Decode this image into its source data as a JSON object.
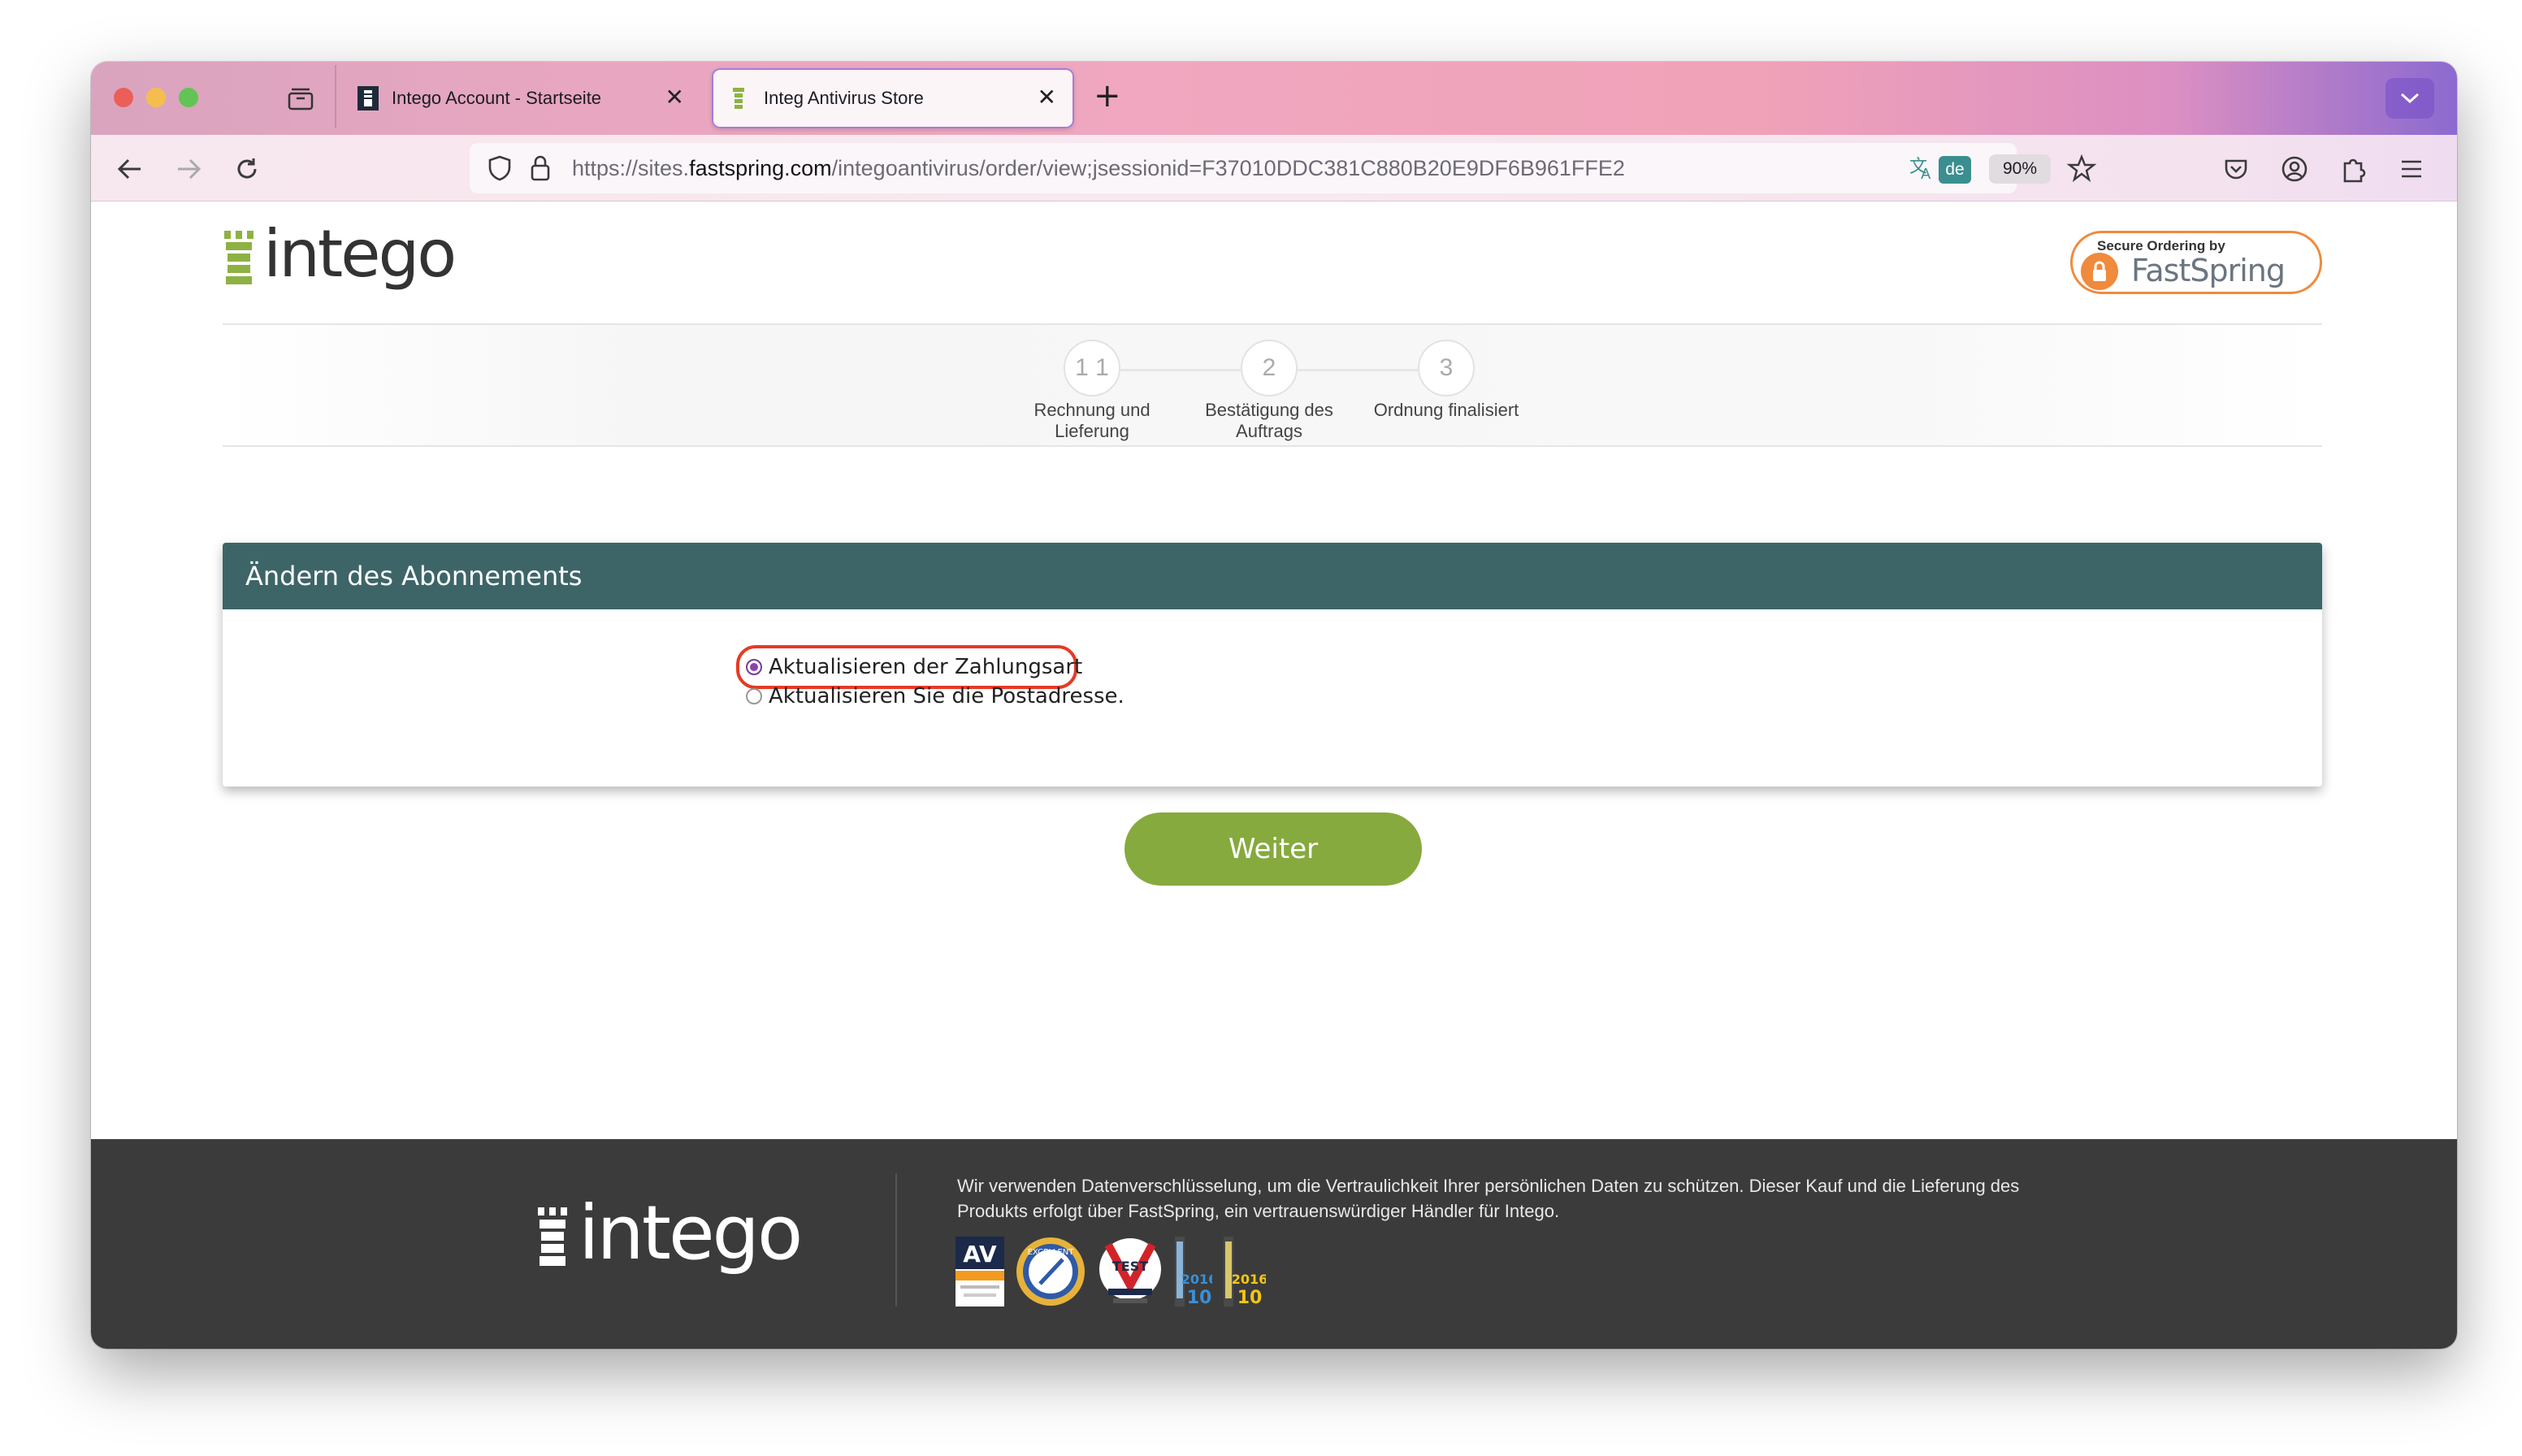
{
  "browser": {
    "tabs": [
      {
        "title": "Intego Account - Startseite",
        "active": false
      },
      {
        "title": "Integ Antivirus Store",
        "active": true
      }
    ],
    "url": {
      "prefix": "https://sites.",
      "domain": "fastspring.com",
      "path": "/integoantivirus/order/view;jsessionid=F37010DDC381C880B20E9DF6B961FFE2"
    },
    "translate_lang": "de",
    "zoom": "90%"
  },
  "page": {
    "logo_text": "intego",
    "secure_badge": {
      "small": "Secure Ordering by",
      "big": "FastSpring"
    },
    "steps": [
      {
        "number": "1 1",
        "label": "Rechnung und Lieferung"
      },
      {
        "number": "2",
        "label": "Bestätigung des Auftrags"
      },
      {
        "number": "3",
        "label": "Ordnung finalisiert"
      }
    ],
    "panel": {
      "title": "Ändern des Abonnements",
      "options": [
        {
          "label": "Aktualisieren der Zahlungsart",
          "checked": true
        },
        {
          "label": "Aktualisieren Sie die Postadresse.",
          "checked": false
        }
      ]
    },
    "continue_label": "Weiter"
  },
  "footer": {
    "logo_text": "intego",
    "text": "Wir verwenden Datenverschlüsselung, um die Vertraulichkeit Ihrer persönlichen Daten zu schützen. Dieser Kauf und die Lieferung des Produkts erfolgt über FastSpring, ein vertrauenswürdiger Händler für Intego.",
    "badges": [
      {
        "name": "av-comparatives-badge",
        "text": "AV"
      },
      {
        "name": "excellent-seal-badge",
        "text": "EXCELLENT"
      },
      {
        "name": "av-test-badge",
        "text": "TEST"
      },
      {
        "name": "tophat-2016-badge-1",
        "text": "2016"
      },
      {
        "name": "tophat-2016-badge-2",
        "text": "2016"
      }
    ]
  },
  "colors": {
    "panel_header": "#3d6568",
    "button": "#86aa3d",
    "highlight": "#e53b25",
    "footer": "#3b3b3b",
    "accent_orange": "#f08a3c"
  }
}
